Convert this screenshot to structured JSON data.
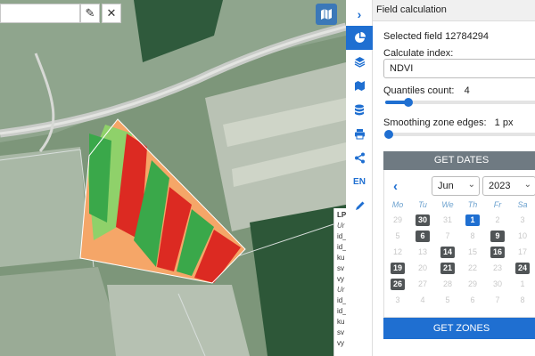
{
  "map": {
    "search_value": "",
    "info_strip": [
      {
        "text": "LP",
        "style": "lp"
      },
      {
        "text": "Ur",
        "style": "it"
      },
      {
        "text": "id_",
        "style": ""
      },
      {
        "text": "id_",
        "style": ""
      },
      {
        "text": "ku",
        "style": ""
      },
      {
        "text": "sv",
        "style": ""
      },
      {
        "text": "vy",
        "style": ""
      },
      {
        "text": "Ur",
        "style": "it"
      },
      {
        "text": "id_",
        "style": ""
      },
      {
        "text": "id_",
        "style": ""
      },
      {
        "text": "ku",
        "style": ""
      },
      {
        "text": "sv",
        "style": ""
      },
      {
        "text": "vy",
        "style": ""
      }
    ]
  },
  "rail": {
    "lang": "EN"
  },
  "panel": {
    "title": "Field calculation",
    "selected_field": "Selected field 12784294",
    "calc_index_label": "Calculate index:",
    "calc_index_value": "NDVI",
    "quantiles_label": "Quantiles count:",
    "quantiles_value": "4",
    "quantiles_fraction": 0.15,
    "smoothing_label": "Smoothing zone edges:",
    "smoothing_value": "1 px",
    "smoothing_fraction": 0.02,
    "get_dates_label": "GET DATES",
    "get_zones_label": "GET ZONES",
    "colors": {
      "accent": "#1f6fd1",
      "available_day": "#505456",
      "button_gray": "#6f7a82"
    }
  },
  "calendar": {
    "month": "Jun",
    "year": "2023",
    "weekdays": [
      "Mo",
      "Tu",
      "We",
      "Th",
      "Fr",
      "Sa"
    ],
    "weeks": [
      [
        {
          "d": "29",
          "s": "muted"
        },
        {
          "d": "30",
          "s": "avail"
        },
        {
          "d": "31",
          "s": "muted"
        },
        {
          "d": "1",
          "s": "selected"
        },
        {
          "d": "2",
          "s": "muted"
        },
        {
          "d": "3",
          "s": "muted"
        }
      ],
      [
        {
          "d": "5",
          "s": "muted"
        },
        {
          "d": "6",
          "s": "avail"
        },
        {
          "d": "7",
          "s": "muted"
        },
        {
          "d": "8",
          "s": "muted"
        },
        {
          "d": "9",
          "s": "avail"
        },
        {
          "d": "10",
          "s": "muted"
        }
      ],
      [
        {
          "d": "12",
          "s": "muted"
        },
        {
          "d": "13",
          "s": "muted"
        },
        {
          "d": "14",
          "s": "avail"
        },
        {
          "d": "15",
          "s": "muted"
        },
        {
          "d": "16",
          "s": "avail"
        },
        {
          "d": "17",
          "s": "muted"
        }
      ],
      [
        {
          "d": "19",
          "s": "avail"
        },
        {
          "d": "20",
          "s": "muted"
        },
        {
          "d": "21",
          "s": "avail"
        },
        {
          "d": "22",
          "s": "muted"
        },
        {
          "d": "23",
          "s": "muted"
        },
        {
          "d": "24",
          "s": "avail"
        }
      ],
      [
        {
          "d": "26",
          "s": "avail"
        },
        {
          "d": "27",
          "s": "muted"
        },
        {
          "d": "28",
          "s": "muted"
        },
        {
          "d": "29",
          "s": "muted"
        },
        {
          "d": "30",
          "s": "muted"
        },
        {
          "d": "1",
          "s": "muted"
        }
      ],
      [
        {
          "d": "3",
          "s": "muted"
        },
        {
          "d": "4",
          "s": "muted"
        },
        {
          "d": "5",
          "s": "muted"
        },
        {
          "d": "6",
          "s": "muted"
        },
        {
          "d": "7",
          "s": "muted"
        },
        {
          "d": "8",
          "s": "muted"
        }
      ]
    ]
  }
}
